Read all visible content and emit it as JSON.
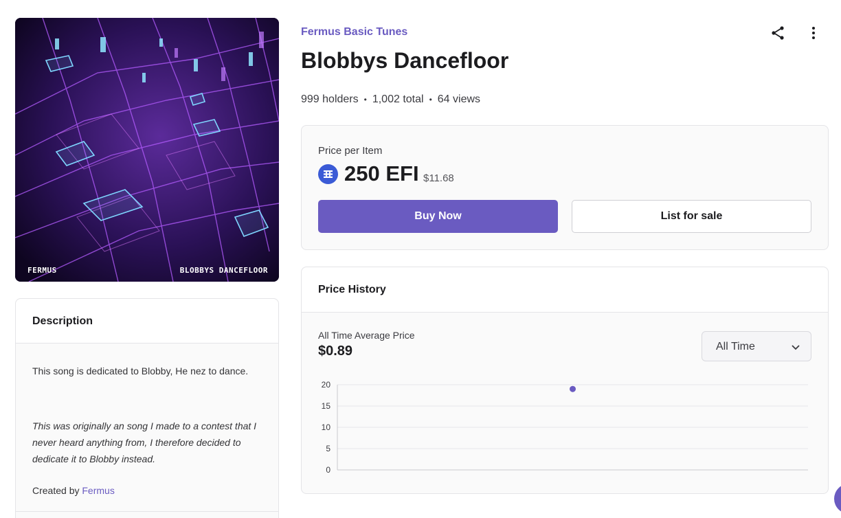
{
  "artwork": {
    "caption_left": "FERMUS",
    "caption_right": "BLOBBYS DANCEFLOOR"
  },
  "description": {
    "heading": "Description",
    "line1": "This song is dedicated to Blobby, He nez to dance.",
    "italic_text": "This was originally an song I made to a contest that I never heard anything from, I therefore decided to dedicate it to Blobby instead.",
    "created_by_label": "Created by",
    "creator": "Fermus"
  },
  "header": {
    "collection": "Fermus Basic Tunes",
    "title": "Blobbys Dancefloor",
    "icons": [
      "share-icon",
      "more-vertical-icon"
    ]
  },
  "stats": {
    "holders": "999 holders",
    "total": "1,002 total",
    "views": "64 views",
    "separator": "•"
  },
  "price": {
    "label": "Price per Item",
    "amount": "250 EFI",
    "usd": "$11.68",
    "currency_icon": "efi-token-icon",
    "buy_label": "Buy Now",
    "list_label": "List for sale"
  },
  "history": {
    "heading": "Price History",
    "avg_label": "All Time Average Price",
    "avg_value": "$0.89",
    "range_selected": "All Time"
  },
  "colors": {
    "accent": "#6a5bc1",
    "token": "#3b5bd6"
  },
  "chart_data": {
    "type": "scatter",
    "yticks": [
      "0",
      "5",
      "10",
      "15",
      "20"
    ],
    "ylim": [
      0,
      20
    ],
    "xlim": [
      0,
      1
    ],
    "points": [
      {
        "x": 0.5,
        "y": 19
      }
    ],
    "grid": true
  }
}
